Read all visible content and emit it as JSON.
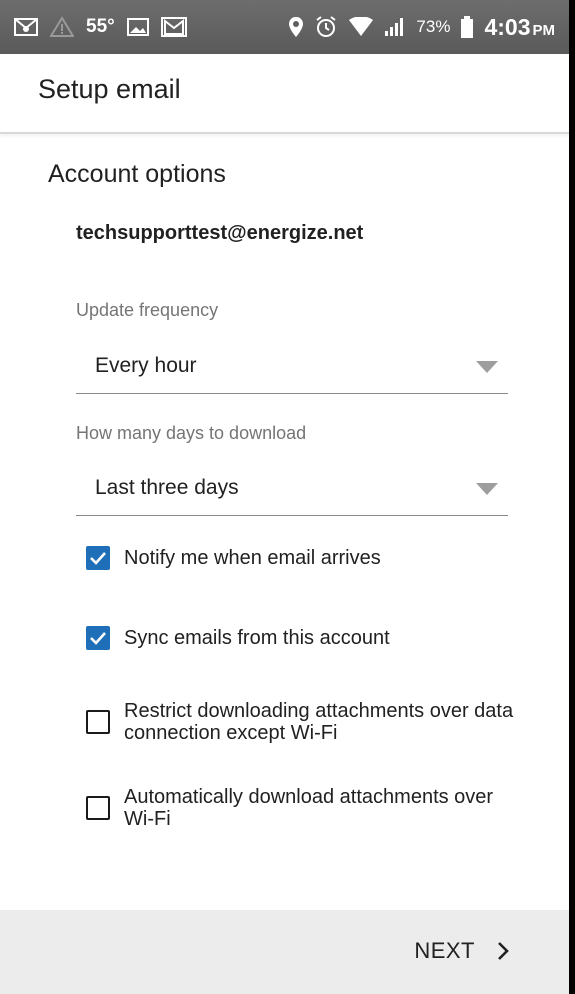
{
  "status_bar": {
    "temperature": "55°",
    "battery_percent": "73%",
    "time": "4:03",
    "ampm": "PM",
    "icons": [
      "email-notification-icon",
      "warning-icon",
      "image-icon",
      "gmail-icon",
      "location-icon",
      "alarm-icon",
      "wifi-icon",
      "signal-icon",
      "battery-icon"
    ]
  },
  "app_bar": {
    "title": "Setup email"
  },
  "account_options": {
    "title": "Account options",
    "email": "techsupporttest@energize.net",
    "update_frequency": {
      "label": "Update frequency",
      "value": "Every hour"
    },
    "days_to_download": {
      "label": "How many days to download",
      "value": "Last three days"
    },
    "checkboxes": [
      {
        "label": "Notify me when email arrives",
        "checked": true
      },
      {
        "label": "Sync emails from this account",
        "checked": true
      },
      {
        "label": "Restrict downloading attachments over data connection except Wi-Fi",
        "checked": false
      },
      {
        "label": "Automatically download attachments over Wi-Fi",
        "checked": false
      }
    ]
  },
  "footer": {
    "next_label": "NEXT"
  },
  "colors": {
    "accent": "#1e6fb8",
    "status_bar": "#5f5f5f",
    "footer_bg": "#ececec"
  }
}
